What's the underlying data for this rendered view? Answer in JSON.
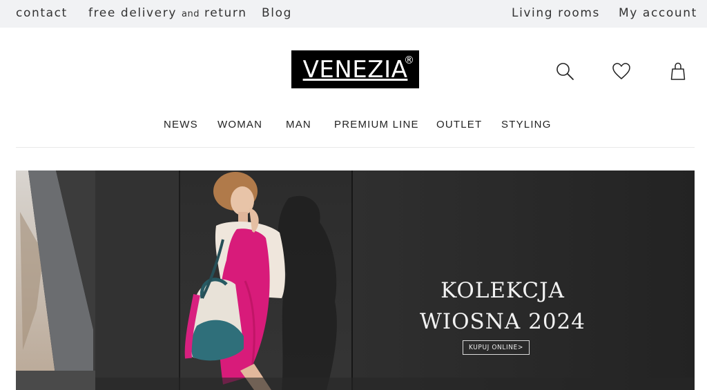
{
  "topbar": {
    "contact": "contact",
    "delivery_a": "free delivery",
    "delivery_and": "and",
    "delivery_b": "return",
    "blog": "Blog",
    "living_rooms": "Living rooms",
    "my_account": "My account"
  },
  "header": {
    "logo_text": "VENEZIA",
    "logo_mark": "®",
    "icons": [
      "search-icon",
      "heart-icon",
      "bag-icon"
    ]
  },
  "nav": {
    "items": [
      {
        "label": "NEWS"
      },
      {
        "label": "WOMAN"
      },
      {
        "label": "MAN"
      },
      {
        "label": "PREMIUM LINE",
        "color": "#b39a7c"
      },
      {
        "label": "OUTLET",
        "color": "#b11b38"
      },
      {
        "label": "STYLING"
      }
    ]
  },
  "hero": {
    "title_line1": "KOLEKCJA",
    "title_line2": "WIOSNA 2024",
    "cta": "KUPUJ ONLINE>"
  },
  "colors": {
    "topbar_bg": "#f1f2f4",
    "premium": "#b39a7c",
    "outlet": "#b11b38",
    "dress": "#d81b7a"
  }
}
